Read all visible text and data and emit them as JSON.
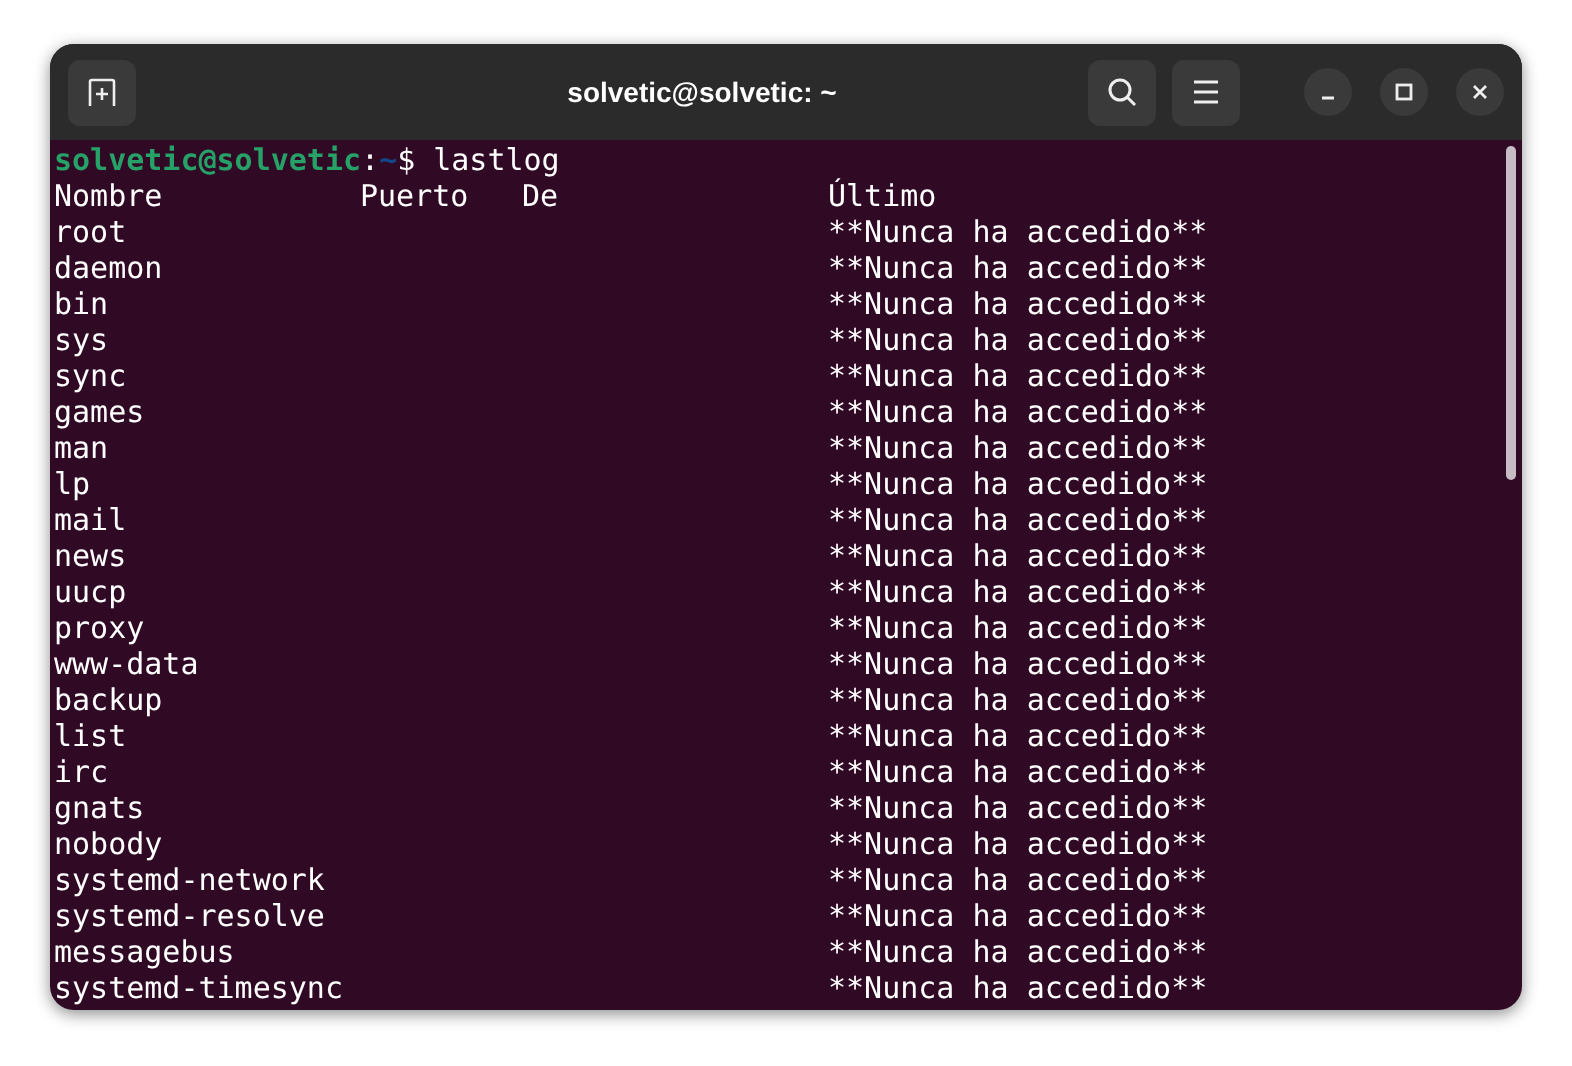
{
  "window": {
    "title": "solvetic@solvetic: ~"
  },
  "prompt": {
    "user_host": "solvetic@solvetic",
    "separator": ":",
    "path": "~",
    "symbol": "$",
    "command": "lastlog"
  },
  "table": {
    "columns": [
      "Nombre",
      "Puerto",
      "De",
      "Último"
    ],
    "rows": [
      {
        "name": "root",
        "last": "**Nunca ha accedido**"
      },
      {
        "name": "daemon",
        "last": "**Nunca ha accedido**"
      },
      {
        "name": "bin",
        "last": "**Nunca ha accedido**"
      },
      {
        "name": "sys",
        "last": "**Nunca ha accedido**"
      },
      {
        "name": "sync",
        "last": "**Nunca ha accedido**"
      },
      {
        "name": "games",
        "last": "**Nunca ha accedido**"
      },
      {
        "name": "man",
        "last": "**Nunca ha accedido**"
      },
      {
        "name": "lp",
        "last": "**Nunca ha accedido**"
      },
      {
        "name": "mail",
        "last": "**Nunca ha accedido**"
      },
      {
        "name": "news",
        "last": "**Nunca ha accedido**"
      },
      {
        "name": "uucp",
        "last": "**Nunca ha accedido**"
      },
      {
        "name": "proxy",
        "last": "**Nunca ha accedido**"
      },
      {
        "name": "www-data",
        "last": "**Nunca ha accedido**"
      },
      {
        "name": "backup",
        "last": "**Nunca ha accedido**"
      },
      {
        "name": "list",
        "last": "**Nunca ha accedido**"
      },
      {
        "name": "irc",
        "last": "**Nunca ha accedido**"
      },
      {
        "name": "gnats",
        "last": "**Nunca ha accedido**"
      },
      {
        "name": "nobody",
        "last": "**Nunca ha accedido**"
      },
      {
        "name": "systemd-network",
        "last": "**Nunca ha accedido**"
      },
      {
        "name": "systemd-resolve",
        "last": "**Nunca ha accedido**"
      },
      {
        "name": "messagebus",
        "last": "**Nunca ha accedido**"
      },
      {
        "name": "systemd-timesync",
        "last": "**Nunca ha accedido**"
      }
    ]
  }
}
